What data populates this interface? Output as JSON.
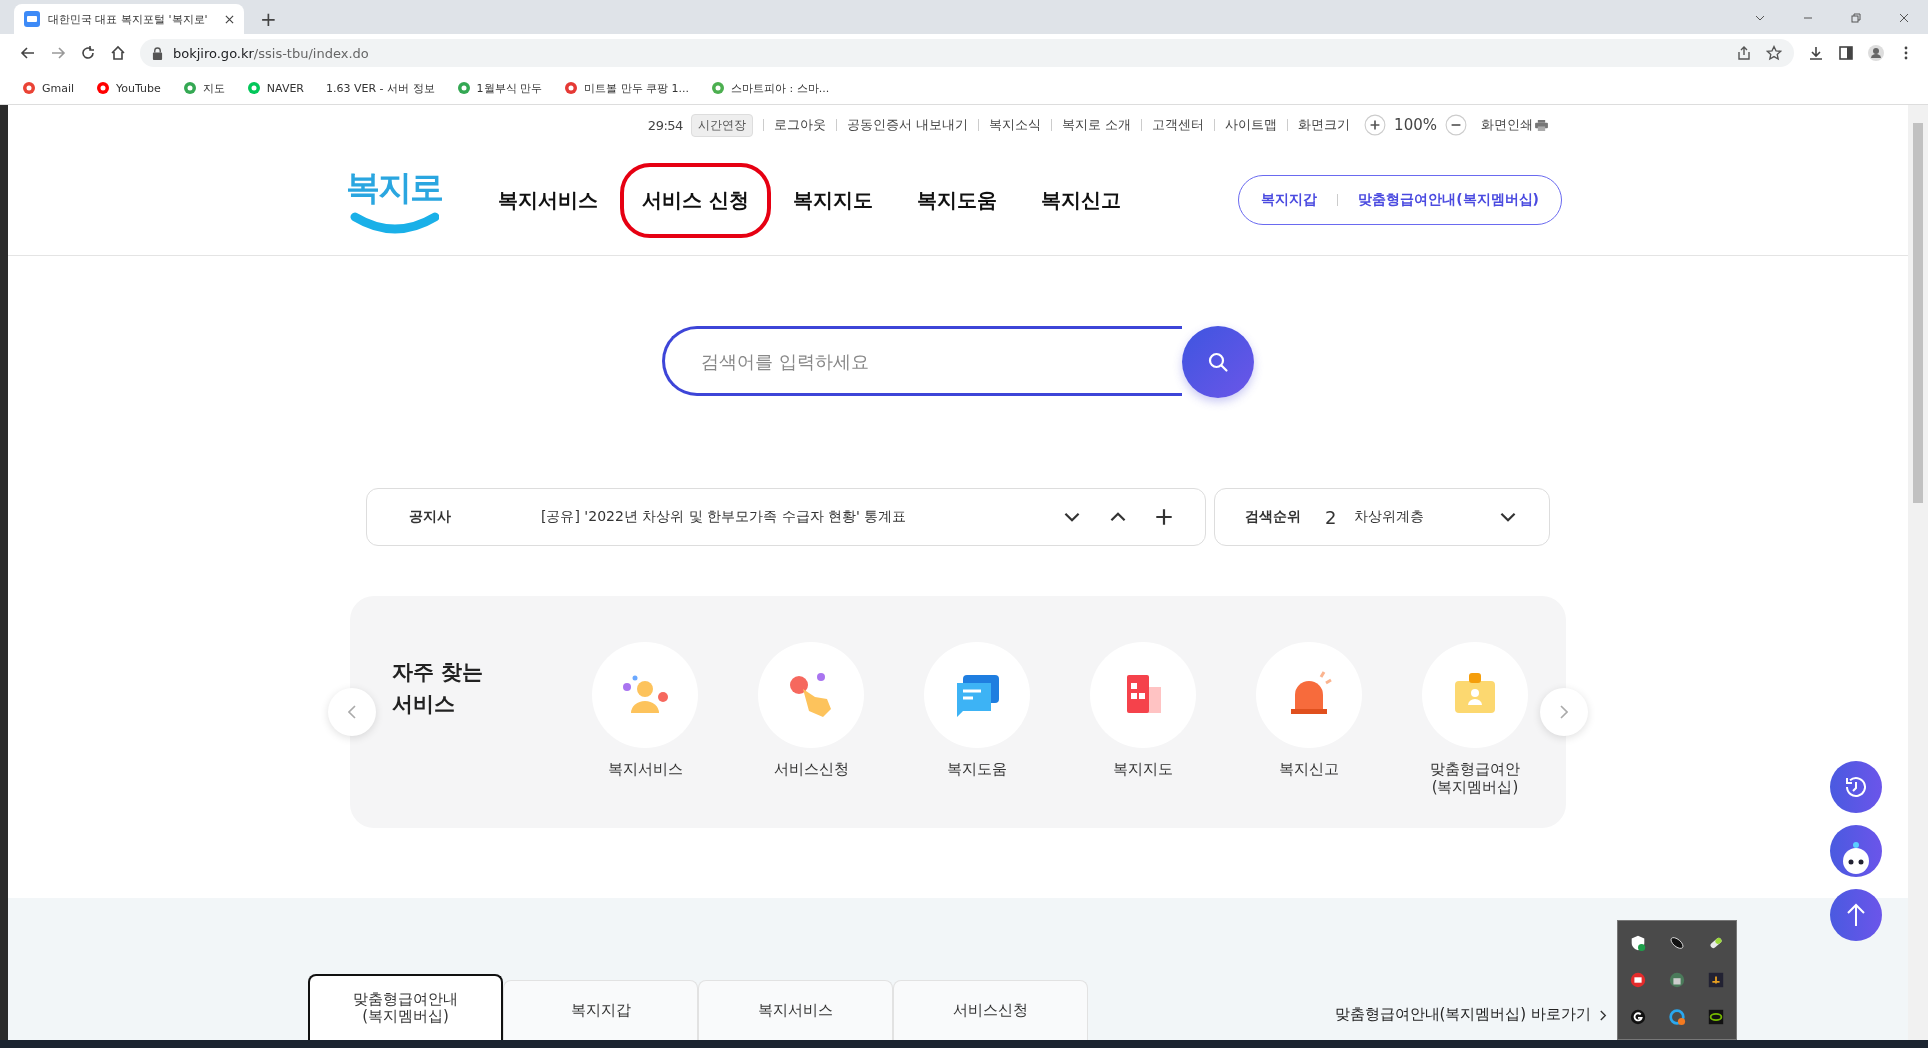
{
  "browser": {
    "tab_title": "대한민국 대표 복지포털 '복지로'",
    "new_tab": "+",
    "url_host": "bokjiro.go.kr",
    "url_path": "/ssis-tbu/index.do",
    "bookmarks": [
      {
        "label": "Gmail",
        "kind": "gmail"
      },
      {
        "label": "YouTube",
        "kind": "youtube"
      },
      {
        "label": "지도",
        "kind": "maps"
      },
      {
        "label": "NAVER",
        "kind": "naver"
      },
      {
        "label": "1.63 VER - 서버 정보",
        "kind": "none"
      },
      {
        "label": "1월부식 만두",
        "kind": "g"
      },
      {
        "label": "미트볼 만두 쿠팡 1...",
        "kind": "c"
      },
      {
        "label": "스마트피아 : 스마...",
        "kind": "w"
      }
    ]
  },
  "utility": {
    "timer": "29:54",
    "extend": "시간연장",
    "links": [
      "로그아웃",
      "공동인증서 내보내기",
      "복지소식",
      "복지로 소개",
      "고객센터",
      "사이트맵",
      "화면크기"
    ],
    "zoom": "100%",
    "print": "화면인쇄"
  },
  "nav": {
    "logo": "복지로",
    "items": [
      {
        "label": "복지서비스",
        "highlighted": false
      },
      {
        "label": "서비스 신청",
        "highlighted": true
      },
      {
        "label": "복지지도",
        "highlighted": false
      },
      {
        "label": "복지도움",
        "highlighted": false
      },
      {
        "label": "복지신고",
        "highlighted": false
      }
    ],
    "quick_links": [
      "복지지갑",
      "맞춤형급여안내(복지멤버십)"
    ]
  },
  "search": {
    "placeholder": "검색어를 입력하세요"
  },
  "notice": {
    "label": "공지사",
    "text": "[공유] '2022년 차상위 및 한부모가족 수급자 현황' 통계표"
  },
  "ranking": {
    "label": "검색순위",
    "rank": "2",
    "term": "차상위계층"
  },
  "services": {
    "title": "자주 찾는\n서비스",
    "items": [
      {
        "label": "복지서비스",
        "kind": "person"
      },
      {
        "label": "서비스신청",
        "kind": "hand"
      },
      {
        "label": "복지도움",
        "kind": "chat"
      },
      {
        "label": "복지지도",
        "kind": "map"
      },
      {
        "label": "복지신고",
        "kind": "siren"
      },
      {
        "label": "맞춤형급여안\n(복지멤버십)",
        "kind": "badge"
      }
    ]
  },
  "bottom_tabs": {
    "tabs": [
      {
        "label": "맞춤형급여안내\n(복지멤버십)",
        "selected": true
      },
      {
        "label": "복지지갑",
        "selected": false
      },
      {
        "label": "복지서비스",
        "selected": false
      },
      {
        "label": "서비스신청",
        "selected": false
      }
    ],
    "link": "맞춤형급여안내(복지멤버십) 바로가기"
  }
}
